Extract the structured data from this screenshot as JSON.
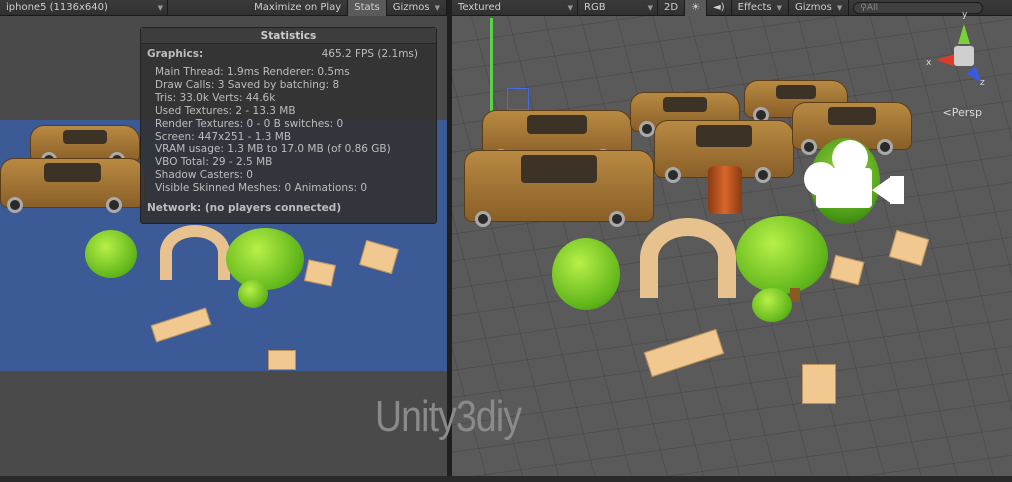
{
  "game": {
    "resolution": "iphone5 (1136x640)",
    "maximize": "Maximize on Play",
    "stats_button": "Stats",
    "gizmos": "Gizmos"
  },
  "stats": {
    "title": "Statistics",
    "graphics_label": "Graphics:",
    "fps": "465.2 FPS (2.1ms)",
    "rows": [
      "Main Thread: 1.9ms  Renderer: 0.5ms",
      "Draw Calls: 3   Saved by batching: 8",
      "Tris: 33.0k   Verts: 44.6k",
      "Used Textures: 2 - 13.3 MB",
      "Render Textures: 0 - 0 B   switches: 0",
      "Screen: 447x251 - 1.3 MB",
      "VRAM usage: 1.3 MB to 17.0 MB (of 0.86 GB)",
      "VBO Total: 29 - 2.5 MB",
      "Shadow Casters: 0",
      "Visible Skinned Meshes: 0      Animations: 0"
    ],
    "network": "Network: (no players connected)"
  },
  "scene": {
    "render_mode": "Textured",
    "color_mode": "RGB",
    "mode_2d": "2D",
    "effects": "Effects",
    "gizmos": "Gizmos",
    "search_placeholder": "All",
    "persp": "Persp",
    "axis_y": "y",
    "axis_x": "x",
    "axis_z": "z"
  },
  "watermark": "Unity3diy"
}
